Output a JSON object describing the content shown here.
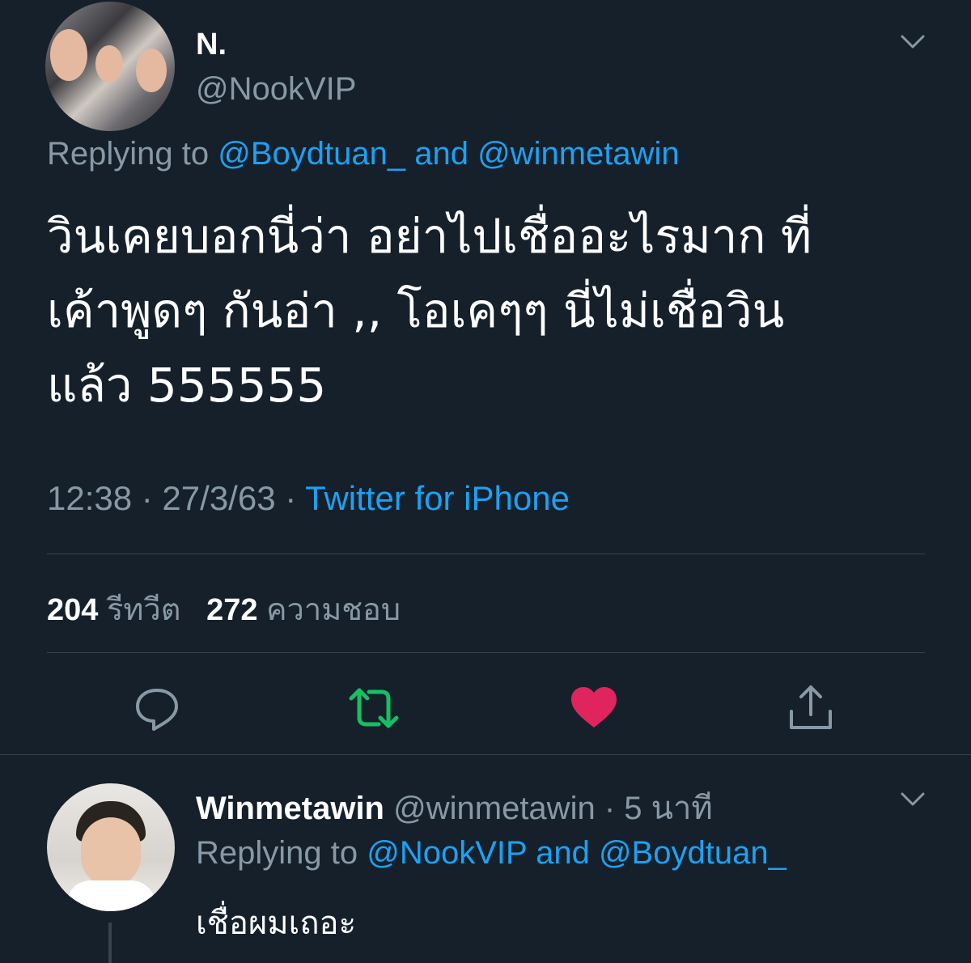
{
  "main_tweet": {
    "author_name": "N.",
    "author_handle": "@NookVIP",
    "replying_prefix": "Replying to ",
    "replying_to_1": "@Boydtuan_",
    "replying_and": " and ",
    "replying_to_2": "@winmetawin",
    "text": "วินเคยบอกนี่ว่า อย่าไปเชื่ออะไรมาก ที่\nเค้าพูดๆ กันอ่า ,, โอเคๆๆ นี่ไม่เชื่อวิน\nแล้ว 555555",
    "time": "12:38 · 27/3/63 · ",
    "source": "Twitter for iPhone",
    "retweet_count": "204",
    "retweet_label": "รีทวีต",
    "like_count": "272",
    "like_label": "ความชอบ"
  },
  "reply_tweet": {
    "author_name": "Winmetawin",
    "author_handle": "@winmetawin",
    "time_sep": " · ",
    "time_ago": "5 นาที",
    "replying_prefix": "Replying to ",
    "replying_to_1": "@NookVIP",
    "replying_and": " and ",
    "replying_to_2": "@Boydtuan_",
    "text": "เชื่อผมเถอะ"
  },
  "icons": [
    "reply-icon",
    "retweet-icon",
    "like-icon",
    "share-icon",
    "chevron-down-icon"
  ],
  "colors": {
    "background": "#15202b",
    "secondary_text": "#8899a6",
    "link": "#1da1f2",
    "retweet_active": "#17bf63",
    "like_active": "#e0245e",
    "divider": "#38444d"
  }
}
